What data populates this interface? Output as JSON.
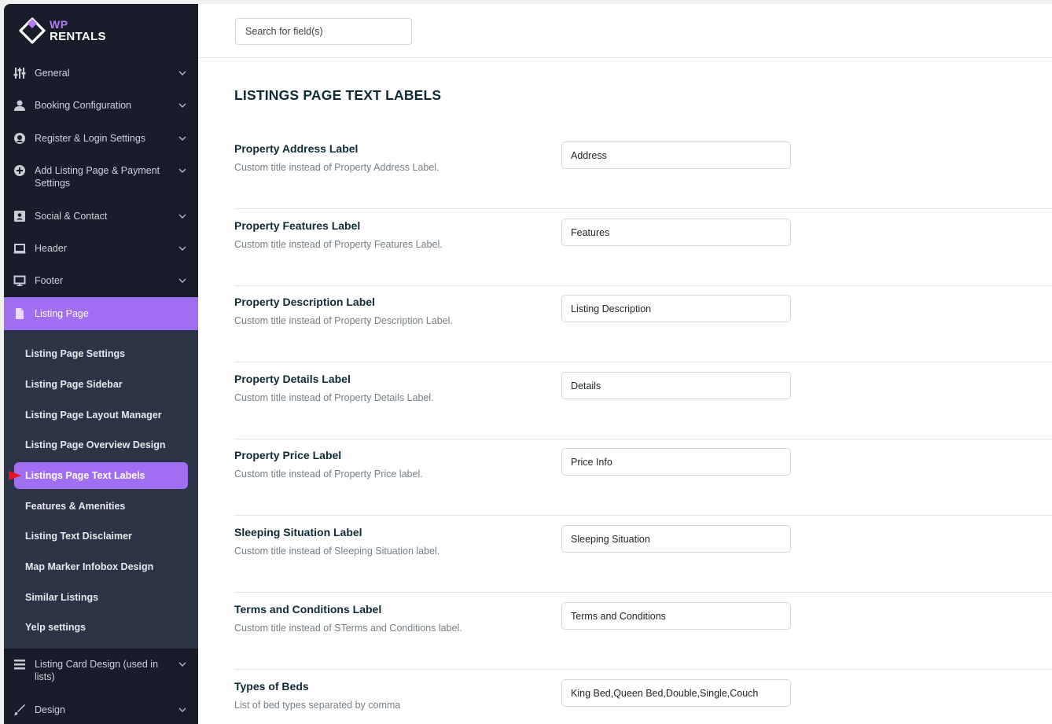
{
  "brand": {
    "line1": "WP",
    "line2": "RENTALS"
  },
  "colors": {
    "sidebar_bg": "#191d29",
    "submenu_bg": "#2c3448",
    "accent": "#a06ef0",
    "pointer": "#e8141e"
  },
  "sidebar": {
    "items": [
      {
        "label": "General",
        "icon": "sliders-icon"
      },
      {
        "label": "Booking Configuration",
        "icon": "user-icon"
      },
      {
        "label": "Register & Login Settings",
        "icon": "login-icon"
      },
      {
        "label": "Add Listing Page & Payment Settings",
        "icon": "plus-circle-icon"
      },
      {
        "label": "Social & Contact",
        "icon": "contact-card-icon"
      },
      {
        "label": "Header",
        "icon": "laptop-icon"
      },
      {
        "label": "Footer",
        "icon": "monitor-icon"
      },
      {
        "label": "Listing Page",
        "icon": "document-icon"
      }
    ],
    "submenu": [
      {
        "label": "Listing Page Settings"
      },
      {
        "label": "Listing Page Sidebar"
      },
      {
        "label": "Listing Page Layout Manager"
      },
      {
        "label": "Listing Page Overview Design"
      },
      {
        "label": "Listings Page Text Labels"
      },
      {
        "label": "Features & Amenities"
      },
      {
        "label": "Listing Text Disclaimer"
      },
      {
        "label": "Map Marker Infobox Design"
      },
      {
        "label": "Similar Listings"
      },
      {
        "label": "Yelp settings"
      }
    ],
    "bottom_items": [
      {
        "label": "Listing Card Design (used in lists)",
        "icon": "list-icon"
      },
      {
        "label": "Design",
        "icon": "brush-icon"
      }
    ]
  },
  "search": {
    "placeholder": "Search for field(s)"
  },
  "page_title": "LISTINGS PAGE TEXT LABELS",
  "fields": [
    {
      "label": "Property Address Label",
      "desc": "Custom title instead of Property Address Label.",
      "value": "Address"
    },
    {
      "label": "Property Features Label",
      "desc": "Custom title instead of Property Features Label.",
      "value": "Features"
    },
    {
      "label": "Property Description Label",
      "desc": "Custom title instead of Property Description Label.",
      "value": "Listing Description"
    },
    {
      "label": "Property Details Label",
      "desc": "Custom title instead of Property Details Label.",
      "value": "Details"
    },
    {
      "label": "Property Price Label",
      "desc": "Custom title instead of Property Price label.",
      "value": "Price Info"
    },
    {
      "label": "Sleeping Situation Label",
      "desc": "Custom title instead of Sleeping Situation label.",
      "value": "Sleeping Situation"
    },
    {
      "label": "Terms and Conditions Label",
      "desc": "Custom title instead of STerms and Conditions label.",
      "value": "Terms and Conditions"
    },
    {
      "label": "Types of Beds",
      "desc": "List of bed types separated by comma",
      "value": "King Bed,Queen Bed,Double,Single,Couch"
    }
  ]
}
